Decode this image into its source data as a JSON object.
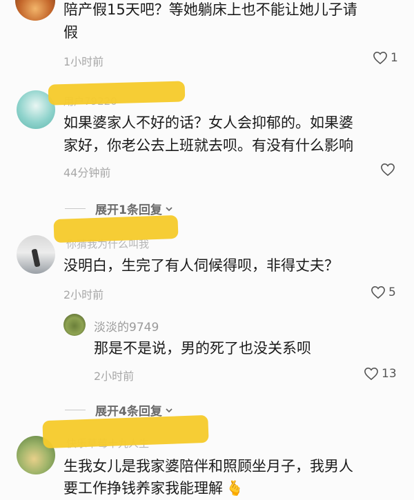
{
  "comments": [
    {
      "text_line1": "陪产假15天吧？等她躺床上也不能让她儿子请",
      "text_line2": "假",
      "time": "1小时前",
      "likes": "1"
    },
    {
      "username_partial": "用户79220",
      "text_line1": "如果婆家人不好的话？女人会抑郁的。如果婆",
      "text_line2": "家好，你老公去上班就去呗。有没有什么影响",
      "time": "44分钟前",
      "likes": "",
      "expand_label": "展开1条回复"
    },
    {
      "username_partial": "你猜我为什么叫我",
      "text_line1": "没明白，生完了有人伺候得呗，非得丈夫？",
      "time": "2小时前",
      "likes": "5",
      "reply": {
        "username": "淡淡的9749",
        "text": "那是不是说，男的死了也没关系呗",
        "time": "2小时前",
        "likes": "13"
      },
      "expand_label": "展开4条回复"
    },
    {
      "username_partial": "快乐草莓十九人生",
      "text_line1": "生我女儿是我家婆陪伴和照顾坐月子，我男人",
      "text_line2": "要工作挣钱养家我能理解",
      "emoji": "🫰"
    }
  ],
  "icons": {
    "heart": "heart-outline-icon",
    "chevron": "chevron-down-icon"
  },
  "colors": {
    "redaction": "#f6cb2d",
    "time": "#a7a7a7"
  }
}
